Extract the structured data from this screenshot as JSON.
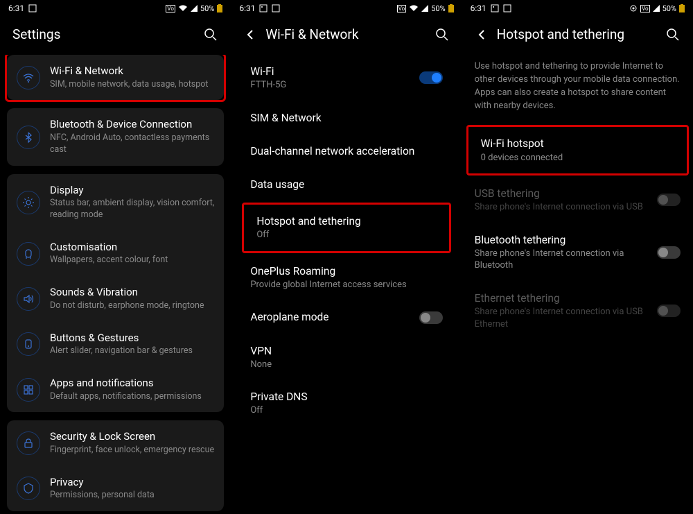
{
  "status": {
    "time": "6:31",
    "battery": "50%"
  },
  "screen1": {
    "title": "Settings",
    "groups": [
      {
        "items": [
          {
            "icon": "wifi",
            "title": "Wi-Fi & Network",
            "sub": "SIM, mobile network, data usage, hotspot",
            "hl": true
          },
          {
            "icon": "bluetooth",
            "title": "Bluetooth & Device Connection",
            "sub": "NFC, Android Auto, contactless payments cast"
          }
        ]
      },
      {
        "items": [
          {
            "icon": "display",
            "title": "Display",
            "sub": "Status bar, ambient display, vision comfort, reading mode"
          },
          {
            "icon": "customisation",
            "title": "Customisation",
            "sub": "Wallpapers, accent colour, font"
          },
          {
            "icon": "sound",
            "title": "Sounds & Vibration",
            "sub": "Do not disturb, earphone mode, ringtone"
          },
          {
            "icon": "buttons",
            "title": "Buttons & Gestures",
            "sub": "Alert slider, navigation bar & gestures"
          },
          {
            "icon": "apps",
            "title": "Apps and notifications",
            "sub": "Default apps, notifications, permissions"
          }
        ]
      },
      {
        "items": [
          {
            "icon": "lock",
            "title": "Security & Lock Screen",
            "sub": "Fingerprint, face unlock, emergency rescue"
          },
          {
            "icon": "privacy",
            "title": "Privacy",
            "sub": "Permissions, personal data"
          }
        ]
      }
    ]
  },
  "screen2": {
    "title": "Wi-Fi & Network",
    "items": [
      {
        "title": "Wi-Fi",
        "sub": "FTTH-5G",
        "toggle": true,
        "on": true
      },
      {
        "title": "SIM & Network"
      },
      {
        "title": "Dual-channel network acceleration"
      },
      {
        "title": "Data usage"
      },
      {
        "title": "Hotspot and tethering",
        "sub": "Off",
        "hl": true
      },
      {
        "title": "OnePlus Roaming",
        "sub": "Provide global Internet access services"
      },
      {
        "title": "Aeroplane mode",
        "toggle": true,
        "on": false
      },
      {
        "title": "VPN",
        "sub": "None"
      },
      {
        "title": "Private DNS",
        "sub": "Off"
      }
    ]
  },
  "screen3": {
    "title": "Hotspot and tethering",
    "description": "Use hotspot and tethering to provide Internet to other devices through your mobile data connection. Apps can also create a hotspot to share content with nearby devices.",
    "items": [
      {
        "title": "Wi-Fi hotspot",
        "sub": "0 devices connected",
        "hl": true
      },
      {
        "title": "USB tethering",
        "sub": "Share phone's Internet connection via USB",
        "toggle": true,
        "on": false,
        "disabled": true
      },
      {
        "title": "Bluetooth tethering",
        "sub": "Share phone's Internet connection via Bluetooth",
        "toggle": true,
        "on": false
      },
      {
        "title": "Ethernet tethering",
        "sub": "Share phone's Internet connection via USB Ethernet",
        "toggle": true,
        "on": false,
        "disabled": true
      }
    ]
  }
}
